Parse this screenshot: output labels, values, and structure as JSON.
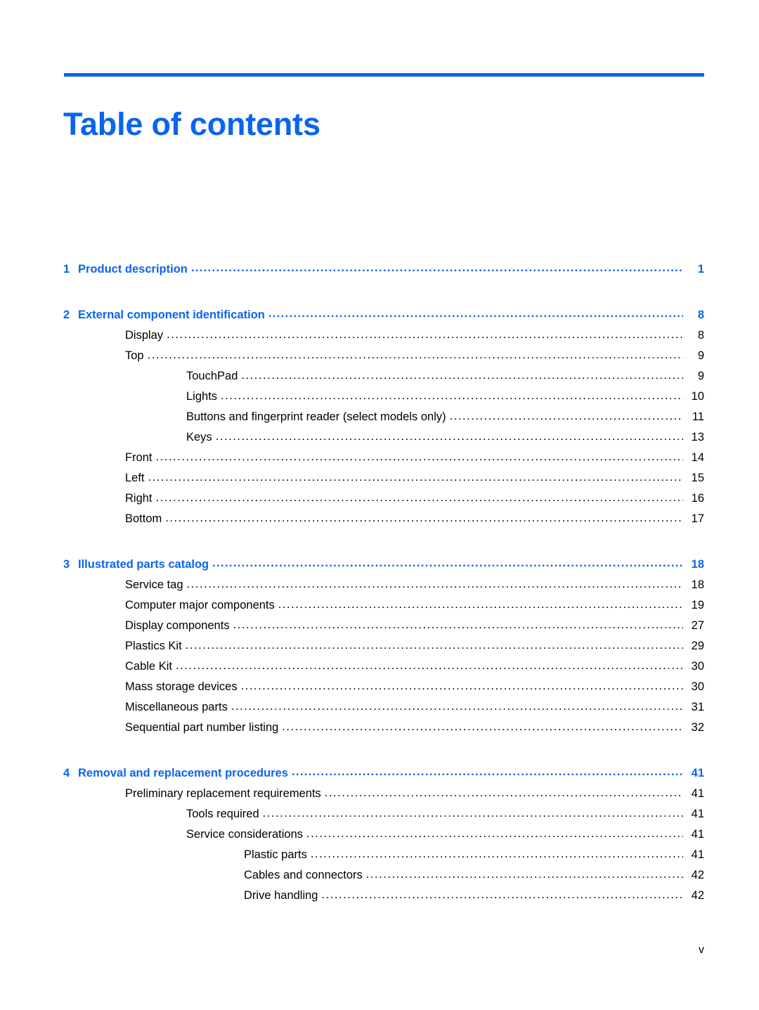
{
  "document": {
    "page_title": "Table of contents",
    "folio": "v",
    "accent_color": "#0a64f0",
    "text_color": "#000000",
    "leader_char": "."
  },
  "toc": {
    "entries": [
      {
        "level": 0,
        "number": "1",
        "label": "Product description",
        "page": "1"
      },
      {
        "level": 0,
        "number": "2",
        "label": "External component identification",
        "page": "8"
      },
      {
        "level": 1,
        "number": "",
        "label": "Display",
        "page": "8"
      },
      {
        "level": 1,
        "number": "",
        "label": "Top",
        "page": "9"
      },
      {
        "level": 2,
        "number": "",
        "label": "TouchPad",
        "page": "9"
      },
      {
        "level": 2,
        "number": "",
        "label": "Lights",
        "page": "10"
      },
      {
        "level": 2,
        "number": "",
        "label": "Buttons and fingerprint reader (select models only)",
        "page": "11"
      },
      {
        "level": 2,
        "number": "",
        "label": "Keys",
        "page": "13"
      },
      {
        "level": 1,
        "number": "",
        "label": "Front",
        "page": "14"
      },
      {
        "level": 1,
        "number": "",
        "label": "Left",
        "page": "15"
      },
      {
        "level": 1,
        "number": "",
        "label": "Right",
        "page": "16"
      },
      {
        "level": 1,
        "number": "",
        "label": "Bottom",
        "page": "17"
      },
      {
        "level": 0,
        "number": "3",
        "label": "Illustrated parts catalog",
        "page": "18"
      },
      {
        "level": 1,
        "number": "",
        "label": "Service tag",
        "page": "18"
      },
      {
        "level": 1,
        "number": "",
        "label": "Computer major components",
        "page": "19"
      },
      {
        "level": 1,
        "number": "",
        "label": "Display components",
        "page": "27"
      },
      {
        "level": 1,
        "number": "",
        "label": "Plastics Kit",
        "page": "29"
      },
      {
        "level": 1,
        "number": "",
        "label": "Cable Kit",
        "page": "30"
      },
      {
        "level": 1,
        "number": "",
        "label": "Mass storage devices",
        "page": "30"
      },
      {
        "level": 1,
        "number": "",
        "label": "Miscellaneous parts",
        "page": "31"
      },
      {
        "level": 1,
        "number": "",
        "label": "Sequential part number listing",
        "page": "32"
      },
      {
        "level": 0,
        "number": "4",
        "label": "Removal and replacement procedures",
        "page": "41"
      },
      {
        "level": 1,
        "number": "",
        "label": "Preliminary replacement requirements",
        "page": "41"
      },
      {
        "level": 2,
        "number": "",
        "label": "Tools required",
        "page": "41"
      },
      {
        "level": 2,
        "number": "",
        "label": "Service considerations",
        "page": "41"
      },
      {
        "level": 3,
        "number": "",
        "label": "Plastic parts",
        "page": "41"
      },
      {
        "level": 3,
        "number": "",
        "label": "Cables and connectors",
        "page": "42"
      },
      {
        "level": 3,
        "number": "",
        "label": "Drive handling",
        "page": "42"
      }
    ]
  }
}
